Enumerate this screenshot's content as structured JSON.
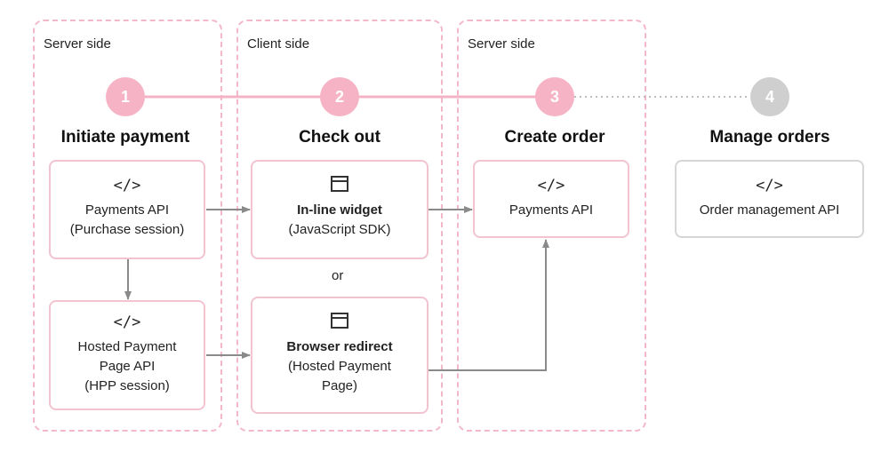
{
  "zones": [
    {
      "label": "Server side"
    },
    {
      "label": "Client side"
    },
    {
      "label": "Server side"
    }
  ],
  "steps": [
    {
      "number": "1",
      "title": "Initiate payment",
      "status": "active"
    },
    {
      "number": "2",
      "title": "Check out",
      "status": "active"
    },
    {
      "number": "3",
      "title": "Create order",
      "status": "active"
    },
    {
      "number": "4",
      "title": "Manage orders",
      "status": "inactive"
    }
  ],
  "cards": {
    "payments_api_purchase": {
      "icon": "code-icon",
      "glyph": "</>",
      "line1": "Payments API",
      "line2": "(Purchase session)"
    },
    "hpp_api": {
      "icon": "code-icon",
      "glyph": "</>",
      "line1": "Hosted Payment",
      "line2": "Page API",
      "line3": "(HPP session)"
    },
    "inline_widget": {
      "icon": "browser-window-icon",
      "title": "In-line widget",
      "subtitle": "(JavaScript SDK)"
    },
    "browser_redirect": {
      "icon": "browser-window-icon",
      "title": "Browser redirect",
      "subtitle1": "(Hosted Payment",
      "subtitle2": "Page)"
    },
    "payments_api_order": {
      "icon": "code-icon",
      "glyph": "</>",
      "line1": "Payments API"
    },
    "order_management_api": {
      "icon": "code-icon",
      "glyph": "</>",
      "line1": "Order management API"
    }
  },
  "or_label": "or",
  "colors": {
    "accent_pink": "#f7b3c6",
    "inactive_gray": "#cfcfcf",
    "arrow_gray": "#8a8a8a"
  }
}
